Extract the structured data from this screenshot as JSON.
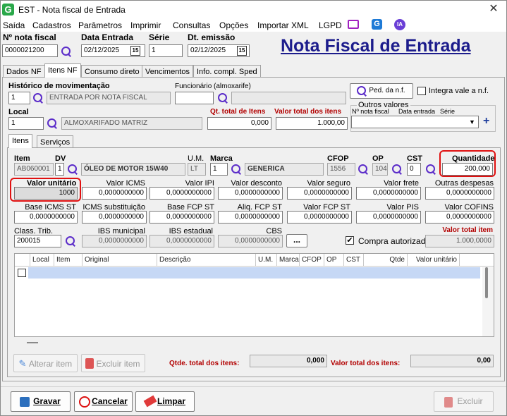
{
  "window": {
    "icon": "G",
    "title": "EST - Nota fiscal de Entrada",
    "close": "✕"
  },
  "menu": [
    "Saída",
    "Cadastros",
    "Parâmetros",
    "Imprimir",
    "Consultas",
    "Opções",
    "Importar XML",
    "LGPD"
  ],
  "menu_icons": {
    "monitor": "monitor-icon",
    "g": "G",
    "ia": "IA"
  },
  "header": {
    "nota_label": "Nº nota fiscal",
    "nota_value": "0000021200",
    "data_entrada_label": "Data Entrada",
    "data_entrada_value": "02/12/2025",
    "serie_label": "Série",
    "serie_value": "1",
    "dt_emissao_label": "Dt. emissão",
    "dt_emissao_value": "02/12/2025",
    "cal_glyph": "15",
    "big_title": "Nota Fiscal de Entrada"
  },
  "tabs": [
    "Dados NF",
    "Itens NF",
    "Consumo direto",
    "Vencimentos",
    "Info. compl. Sped"
  ],
  "itens_nf": {
    "historico_label": "Histórico de movimentação",
    "historico_code": "1",
    "historico_desc": "ENTRADA POR NOTA FISCAL",
    "funcionario_label": "Funcionário (almoxarife)",
    "funcionario_code": "",
    "funcionario_desc": "",
    "ped_button": "Ped. da n.f.",
    "integra_label": "Integra vale a n.f.",
    "local_label": "Local",
    "local_code": "1",
    "local_desc": "ALMOXARIFADO MATRIZ",
    "qt_total_label": "Qt. total de Itens",
    "qt_total_value": "0,000",
    "valor_total_label": "Valor total dos itens",
    "valor_total_value": "1.000,00",
    "outros_valores_label": "Outros valores",
    "outros_cols": [
      "Nº nota fiscal",
      "Data entrada",
      "Série"
    ],
    "plus": "+"
  },
  "subtabs": [
    "Itens",
    "Serviços"
  ],
  "item": {
    "item_label": "Item",
    "item_value": "AB060001",
    "dv_label": "DV",
    "dv_value": "1",
    "desc_value": "ÓLEO DE MOTOR 15W40",
    "um_label": "U.M.",
    "um_value": "LT",
    "marca_label": "Marca",
    "marca_code": "1",
    "marca_desc": "GENERICA",
    "cfop_label": "CFOP",
    "cfop_value": "1556",
    "op_label": "OP",
    "op_value": "104",
    "cst_label": "CST",
    "cst_value": "0",
    "quantidade_label": "Quantidade",
    "quantidade_value": "200,000",
    "valor_unitario_label": "Valor unitário",
    "valor_unitario_value": "1000",
    "row1": [
      {
        "label": "Valor ICMS",
        "value": "0,0000000000"
      },
      {
        "label": "Valor IPI",
        "value": "0,0000000000"
      },
      {
        "label": "Valor desconto",
        "value": "0,0000000000"
      },
      {
        "label": "Valor seguro",
        "value": "0,0000000000"
      },
      {
        "label": "Valor frete",
        "value": "0,0000000000"
      },
      {
        "label": "Outras despesas",
        "value": "0,0000000000"
      }
    ],
    "row2": [
      {
        "label": "Base ICMS ST",
        "value": "0,0000000000"
      },
      {
        "label": "ICMS substituição",
        "value": "0,0000000000"
      },
      {
        "label": "Base FCP ST",
        "value": "0,0000000000"
      },
      {
        "label": "Aliq. FCP ST",
        "value": "0,0000000000"
      },
      {
        "label": "Valor FCP ST",
        "value": "0,0000000000"
      },
      {
        "label": "Valor PIS",
        "value": "0,0000000000"
      },
      {
        "label": "Valor COFINS",
        "value": "0,0000000000"
      }
    ],
    "class_trib_label": "Class. Trib.",
    "class_trib_value": "200015",
    "ibs_mun_label": "IBS municipal",
    "ibs_mun_value": "0,0000000000",
    "ibs_est_label": "IBS estadual",
    "ibs_est_value": "0,0000000000",
    "cbs_label": "CBS",
    "cbs_value": "0,0000000000",
    "dots_button": "...",
    "compra_label": "Compra autorizada",
    "compra_checked": "✔",
    "valor_total_item_label": "Valor total item",
    "valor_total_item_value": "1.000,0000"
  },
  "grid": {
    "columns": [
      "Local",
      "Item",
      "Original",
      "Descrição",
      "U.M.",
      "Marca",
      "CFOP",
      "OP",
      "CST",
      "Qtde",
      "Valor unitário"
    ]
  },
  "footer": {
    "alterar_button": "Alterar item",
    "excluir_item_button": "Excluir item",
    "qtde_total_label": "Qtde. total dos itens:",
    "qtde_total_value": "0,000",
    "valor_total_label": "Valor total dos itens:",
    "valor_total_value": "0,00"
  },
  "actions": {
    "gravar": "Gravar",
    "cancelar": "Cancelar",
    "limpar": "Limpar",
    "excluir": "Excluir"
  },
  "colors": {
    "accent": "#5b2cc9",
    "title_blue": "#1c1c8c",
    "red_label": "#b20000",
    "highlight_box": "#e01010",
    "grid_select": "#c6d8f5"
  }
}
